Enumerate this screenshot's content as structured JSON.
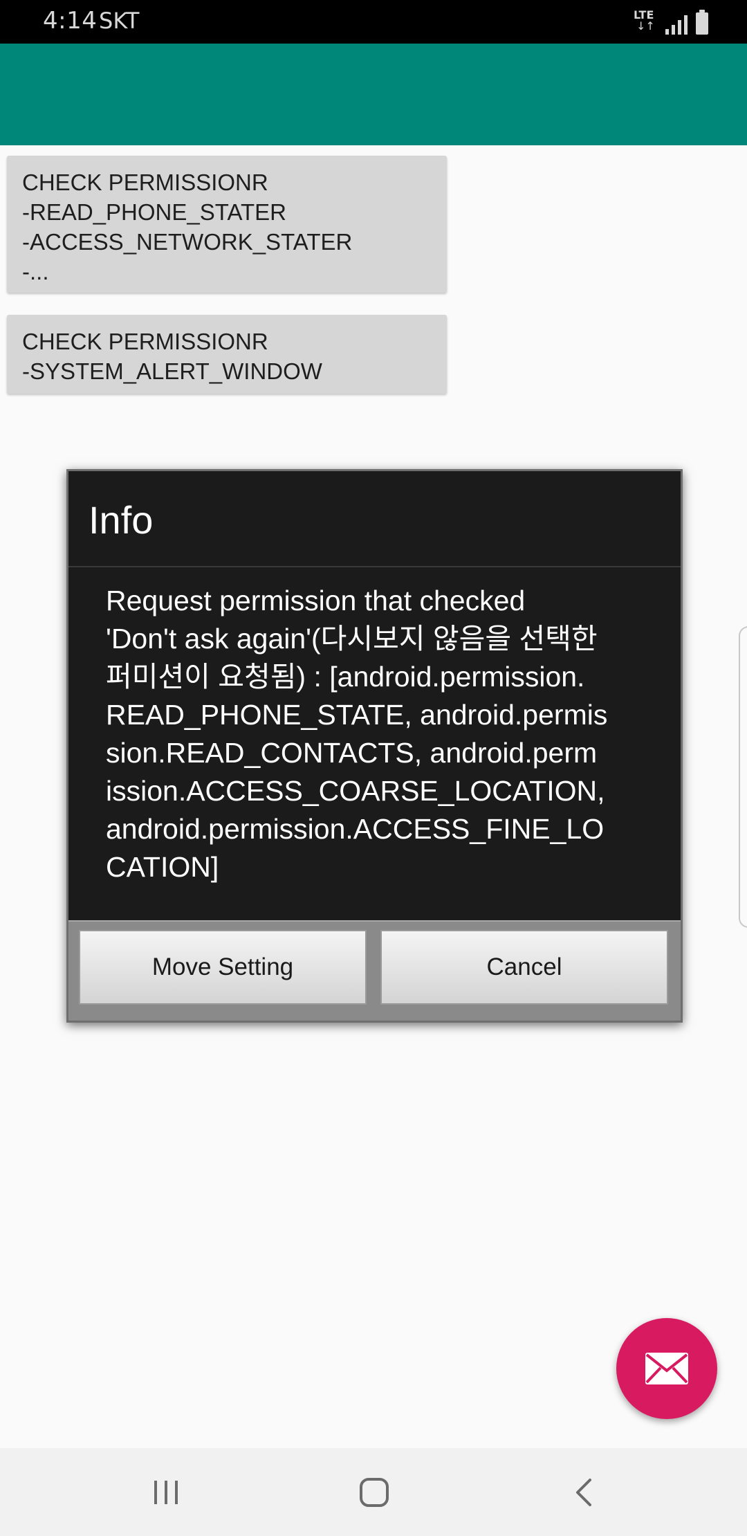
{
  "status_bar": {
    "time": "4:14",
    "carrier": "SKT",
    "network_label": "LTE",
    "network_arrows": "↓↑",
    "icons": [
      "lte-icon",
      "signal-icon",
      "battery-icon"
    ]
  },
  "app_bar": {
    "color": "#00877a"
  },
  "buttons": {
    "check_permission_1": {
      "lines": [
        "CHECK PERMISSIONR",
        "-READ_PHONE_STATER",
        "-ACCESS_NETWORK_STATER",
        "-..."
      ]
    },
    "check_permission_2": {
      "lines": [
        "CHECK PERMISSIONR",
        "-SYSTEM_ALERT_WINDOW"
      ]
    }
  },
  "dialog": {
    "title": "Info",
    "message_lines": [
      "Request permission that checked",
      "'Don't ask again'(다시보지 않음을 선택한",
      "퍼미션이 요청됨) : [android.permission.",
      "READ_PHONE_STATE, android.permis",
      "sion.READ_CONTACTS, android.perm",
      "ission.ACCESS_COARSE_LOCATION,",
      "android.permission.ACCESS_FINE_LO",
      "CATION]"
    ],
    "positive_button": "Move Setting",
    "negative_button": "Cancel"
  },
  "fab": {
    "icon": "mail-icon",
    "color": "#d81b60"
  },
  "nav_bar": {
    "icons": [
      "recents-icon",
      "home-icon",
      "back-icon"
    ]
  }
}
